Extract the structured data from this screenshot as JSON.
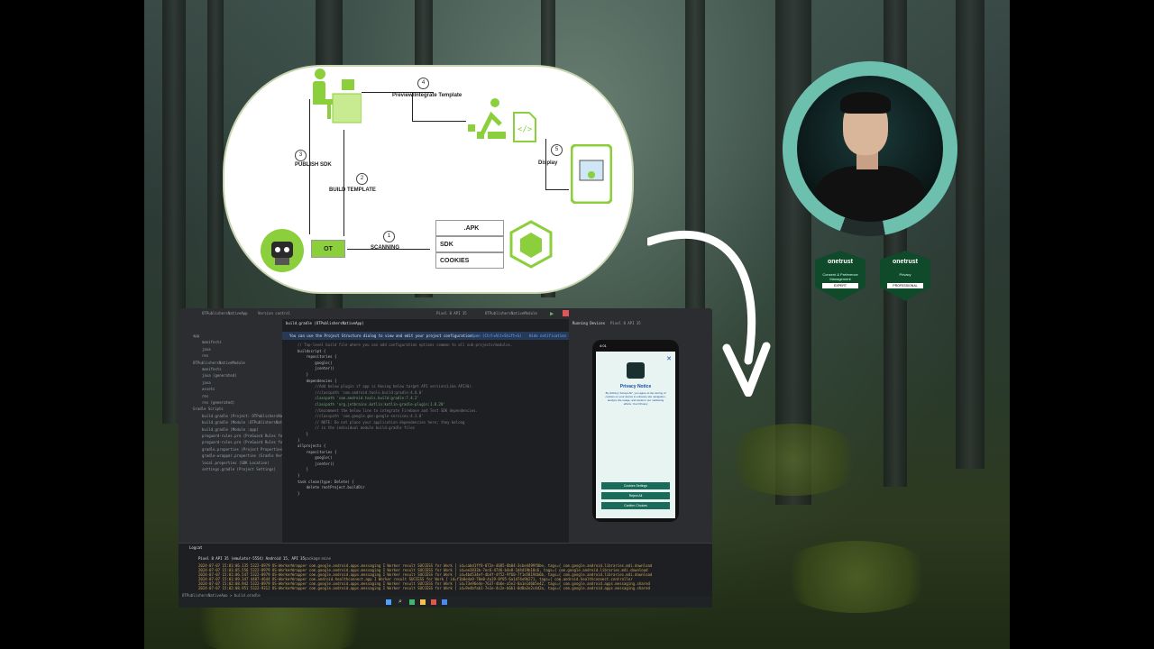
{
  "diagram": {
    "steps": {
      "s1": {
        "num": "1",
        "label": "SCANNING"
      },
      "s2": {
        "num": "2",
        "label": "BUILD TEMPLATE"
      },
      "s3": {
        "num": "3",
        "label": "PUBLISH SDK"
      },
      "s4": {
        "num": "4",
        "label": "Preview\\Integrate Template"
      },
      "s5": {
        "num": "5",
        "label": "Display"
      }
    },
    "ot_label": "OT",
    "scan_items": [
      ".APK",
      "SDK",
      "COOKIES"
    ]
  },
  "badges": [
    {
      "title": "onetrust",
      "subtitle": "Consent & Preference Management",
      "band": "EXPERT"
    },
    {
      "title": "onetrust",
      "subtitle": "Privacy",
      "band": "PROFESSIONAL"
    }
  ],
  "ide": {
    "project_name": "OTPublishersNativeApp",
    "version_control": "Version control",
    "device": "Pixel 8 API 35",
    "run_config": "OTPublishersNativeModule",
    "editor_tab": "build.gradle (OTPublishersNativeApp)",
    "notice": "You can use the Project Structure dialog to view and edit your project configuration",
    "notice_link": "Open (Ctrl+Alt+Shift+S)",
    "notice_hide": "Hide notification",
    "running_devices": "Running Devices",
    "running_device_tab": "Pixel 8 API 35",
    "tree": [
      "app",
      "manifests",
      "java",
      "res",
      "OTPublishersNativeModule",
      "manifests",
      "java (generated)",
      "java",
      "assets",
      "res",
      "res (generated)",
      "Gradle Scripts",
      "build.gradle (Project: OTPublishersNativeApp)",
      "build.gradle (Module :OTPublishersNativeModule)",
      "build.gradle (Module :app)",
      "proguard-rules.pro (ProGuard Rules for ':app')",
      "proguard-rules.pro (ProGuard Rules for ':OTPublishersNativeModule')",
      "gradle.properties (Project Properties)",
      "gradle-wrapper.properties (Gradle Version)",
      "local.properties (SDK Location)",
      "settings.gradle (Project Settings)"
    ],
    "code": [
      "// Top-level build file where you can add configuration options common to all sub-projects/modules.",
      "buildscript {",
      "    repositories {",
      "        google()",
      "        jcenter()",
      "",
      "    }",
      "    dependencies {",
      "        //Add below plugin if app is Having below target API version(Like API30).",
      "        //classpath 'com.android.tools.build:gradle:4.0.0'",
      "        classpath 'com.android.tools.build:gradle:7.4.2'",
      "        classpath 'org.jetbrains.kotlin:kotlin-gradle-plugin:1.8.20'",
      "        //Uncomment the below line to integrate Firebase and Test SDK dependencies.",
      "        //classpath 'com.google.gms:google-services:4.3.0'",
      "        // NOTE: Do not place your application dependencies here; they belong",
      "        // in the individual module build.gradle files",
      "    }",
      "}",
      "",
      "",
      "allprojects {",
      "    repositories {",
      "        google()",
      "        jcenter()",
      "",
      "    }",
      "}",
      "",
      "task clean(type: Delete) {",
      "    delete rootProject.buildDir",
      "}"
    ],
    "logcat_tab": "Logcat",
    "logcat_device": "Pixel 8 API 35 (emulator-5554) Android 15, API 35",
    "logcat_filter": "package:mine",
    "log_lines": [
      "2024-07-07 15:01:06.135  5322-8979  OS-WorkerWrapper   com.google.android.apps.messaging  I  Worker result SUCCESS for Work [ id=cabd1ff8-072e-4685-8b04-3cbe4499f0be, tags={ com.google.android.libraries.mdi.download",
      "2024-07-07 15:01:05.556  5322-8979  OS-WorkerWrapper   com.google.android.apps.messaging  I  Worker result SUCCESS for Work [ id=ee2833b-7ec6-4746-b4e8-1d4d19b18c6, tags={ com.google.android.libraries.mdi.download",
      "2024-07-07 15:01:06.547  5322-8979  OS-WorkerWrapper   com.google.android.apps.messaging  I  Worker result SUCCESS for Work [ id=4bd534ef-4b4f-4f52-9f60-7f1e58194b6b, tags={ com.google.android.libraries.mdi.download",
      "2024-07-07 15:01:09.347  4487-4644  OS-WorkerWrapper   com.android.healthconnect.app  I  Worker result SUCCESS for Work [ id=f1b0e4a9-70e0-4a19-8f85-6a1d74e9b271, tags={ com.android.healthconnect.controller",
      "2024-07-07 15:02:08.942  5322-8979  OS-WorkerWrapper   com.google.android.apps.messaging  I  Worker result SUCCESS for Work [ id=73e96e4e-7637-4b6e-a5e2-8a1e1d6b5e42, tags={ com.google.android.apps.messaging.shared",
      "2024-07-07 15:02:08.951  5322-9312  OS-WorkerWrapper   com.google.android.apps.messaging  I  Worker result SUCCESS for Work [ id=9e4bfab1-7e1e-4c2e-b6b1-0d8a2e2c4d2a, tags={ com.google.android.apps.messaging.shared"
    ],
    "breadcrumb": "OTPublishersNativeApp > build.gradle"
  },
  "phone": {
    "time": "4:01",
    "title": "Privacy Notice",
    "body": "By clicking \"Accept All\", you agree to the storing of cookies on your device to enhance site navigation, analyze site usage, and assist in our marketing efforts. Your Privacy",
    "buttons": [
      "Cookies Settings",
      "Reject All",
      "Confirm Choices"
    ]
  }
}
